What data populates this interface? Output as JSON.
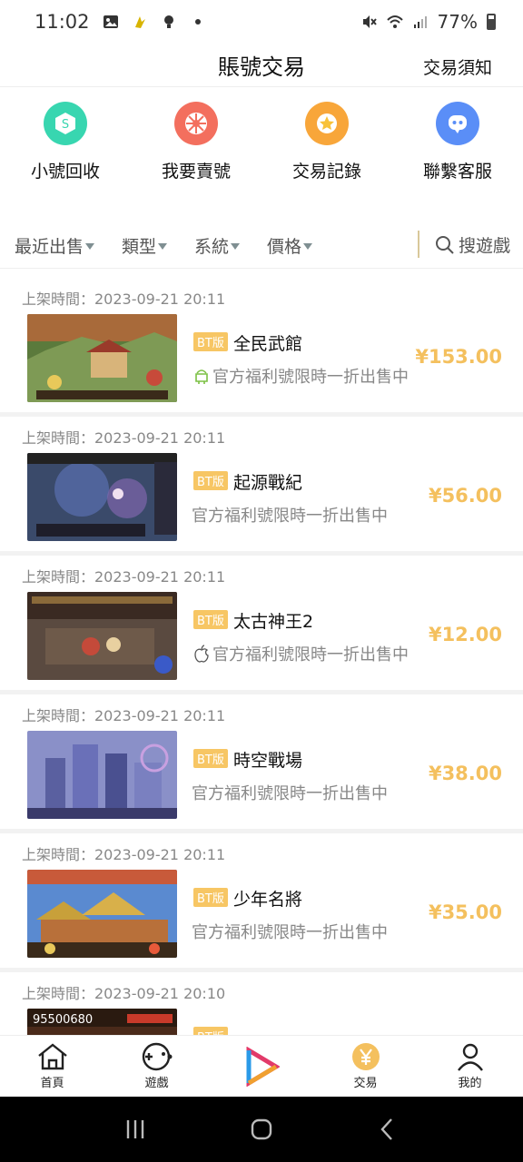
{
  "status_bar": {
    "time": "11:02",
    "battery": "77%"
  },
  "header": {
    "title": "賬號交易",
    "notice_link": "交易須知"
  },
  "quick_actions": [
    {
      "label": "小號回收",
      "color": "#38d6b0",
      "icon": "recycle-s-icon"
    },
    {
      "label": "我要賣號",
      "color": "#f36f5e",
      "icon": "sell-wheel-icon"
    },
    {
      "label": "交易記錄",
      "color": "#f8a63a",
      "icon": "star-record-icon"
    },
    {
      "label": "聯繫客服",
      "color": "#5a8ef7",
      "icon": "support-chat-icon"
    }
  ],
  "filters": {
    "recent": "最近出售",
    "type": "類型",
    "system": "系統",
    "price": "價格",
    "search": "搜遊戲"
  },
  "listings": [
    {
      "time": "上架時間：2023-09-21 20:11",
      "badge": "BT版",
      "name": "全民武館",
      "desc": "官方福利號限時一折出售中",
      "platform": "android",
      "price": "¥153.00",
      "thumb": "thumb-a"
    },
    {
      "time": "上架時間：2023-09-21 20:11",
      "badge": "BT版",
      "name": "起源戰紀",
      "desc": "官方福利號限時一折出售中",
      "platform": "",
      "price": "¥56.00",
      "thumb": "thumb-b"
    },
    {
      "time": "上架時間：2023-09-21 20:11",
      "badge": "BT版",
      "name": "太古神王2",
      "desc": "官方福利號限時一折出售中",
      "platform": "ios",
      "price": "¥12.00",
      "thumb": "thumb-c"
    },
    {
      "time": "上架時間：2023-09-21 20:11",
      "badge": "BT版",
      "name": "時空戰場",
      "desc": "官方福利號限時一折出售中",
      "platform": "",
      "price": "¥38.00",
      "thumb": "thumb-d"
    },
    {
      "time": "上架時間：2023-09-21 20:11",
      "badge": "BT版",
      "name": "少年名將",
      "desc": "官方福利號限時一折出售中",
      "platform": "",
      "price": "¥35.00",
      "thumb": "thumb-e"
    },
    {
      "time": "上架時間：2023-09-21 20:10",
      "badge": "BT版",
      "name": "",
      "desc": "",
      "platform": "",
      "price": "",
      "thumb": "thumb-f"
    }
  ],
  "bottom_nav": [
    {
      "label": "首頁",
      "icon": "home-icon"
    },
    {
      "label": "遊戲",
      "icon": "game-controller-icon"
    },
    {
      "label": "",
      "icon": "play-logo-icon"
    },
    {
      "label": "交易",
      "icon": "yen-coin-icon",
      "active_color": "#f4c05e"
    },
    {
      "label": "我的",
      "icon": "user-icon"
    }
  ]
}
